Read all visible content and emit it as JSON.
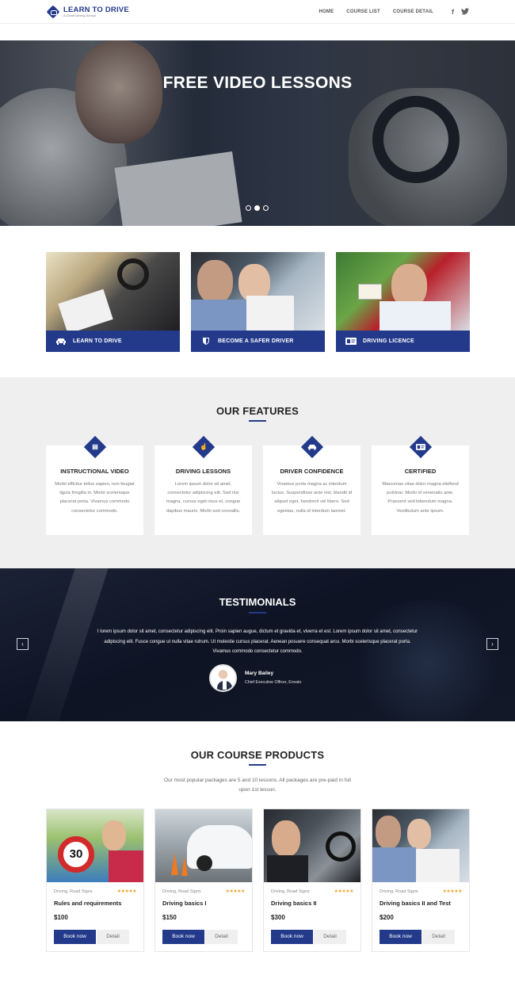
{
  "header": {
    "logo_title": "LEARN TO DRIVE",
    "logo_subtitle": "A Clone Driving School",
    "nav": [
      "HOME",
      "COURSE LIST",
      "COURSE DETAIL"
    ],
    "social": [
      "facebook-icon",
      "twitter-icon"
    ]
  },
  "hero": {
    "title": "FREE VIDEO LESSONS",
    "slides": 3,
    "active_slide": 2
  },
  "cards": [
    {
      "label": "LEARN TO DRIVE",
      "icon": "car-icon"
    },
    {
      "label": "BECOME A SAFER DRIVER",
      "icon": "shield-icon"
    },
    {
      "label": "DRIVING LICENCE",
      "icon": "id-card-icon"
    }
  ],
  "features": {
    "title": "OUR FEATURES",
    "items": [
      {
        "title": "INSTRUCTIONAL VIDEO",
        "icon": "film-icon",
        "text": "Morbi efficitur tellus sapien, non feugiat ligula fringilla in. Morbi scelerisque placerat porta. Vivamus commodo consectetur commodo."
      },
      {
        "title": "DRIVING LESSONS",
        "icon": "thumbs-up-icon",
        "text": "Lorem ipsum dolor sit amet, consectetur adipiscing elit. Sed nisi magna, cursus eget risus et, congue dapibus mauris. Morbi sed convallis."
      },
      {
        "title": "DRIVER CONFIDENCE",
        "icon": "car-icon",
        "text": "Vivamus porta magna ac interdum luctus. Suspendisse ante nisl, blandit id aliquet eget, hendrerit vel libero. Sed egestas, nulla id interdum laoreet."
      },
      {
        "title": "CERTIFIED",
        "icon": "id-card-icon",
        "text": "Maecenas vitae dolor magna eleifend pulvinar. Morbi id venenatis ante. Praesent sed bibendum magna. Vestibulum ante ipsum."
      }
    ]
  },
  "testimonials": {
    "title": "TESTIMONIALS",
    "quote": "I lorem ipsum dolor sit amet, consectetur adipiscing elit. Proin sapien augue, dictum et gravida et, viverra et est. Lorem ipsum dolor sit amet, consectetur adipiscing elit. Fusce congue ut nulla vitae rutrum. Ut molestie cursus placerat. Aenean posuere consequat arcu. Morbi scelerisque placerat porta. Vivamus commodo consectetur commodo.",
    "name": "Mary Bailey",
    "role": "Chief Executive Officer, Envato",
    "prev": "‹",
    "next": "›"
  },
  "courses": {
    "title": "OUR COURSE PRODUCTS",
    "subtitle": "Our most popular packages are 5 and 10 lessons. All packages are pre-paid in full upon 1st lesson.",
    "items": [
      {
        "category": "Driving, Road Signs",
        "stars": "★★★★★",
        "title": "Rules and requirements",
        "price": "$100",
        "book": "Book now",
        "detail": "Detail"
      },
      {
        "category": "Driving, Road Signs",
        "stars": "★★★★★",
        "title": "Driving basics I",
        "price": "$150",
        "book": "Book now",
        "detail": "Detail"
      },
      {
        "category": "Driving, Road Signs",
        "stars": "★★★★★",
        "title": "Driving basics II",
        "price": "$300",
        "book": "Book now",
        "detail": "Detail"
      },
      {
        "category": "Driving, Road Signs",
        "stars": "★★★★★",
        "title": "Driving basics II and Test",
        "price": "$200",
        "book": "Book now",
        "detail": "Detail"
      }
    ]
  },
  "colors": {
    "brand": "#233a8b",
    "star": "#f0a32a",
    "dark_section": "#0e1424"
  }
}
